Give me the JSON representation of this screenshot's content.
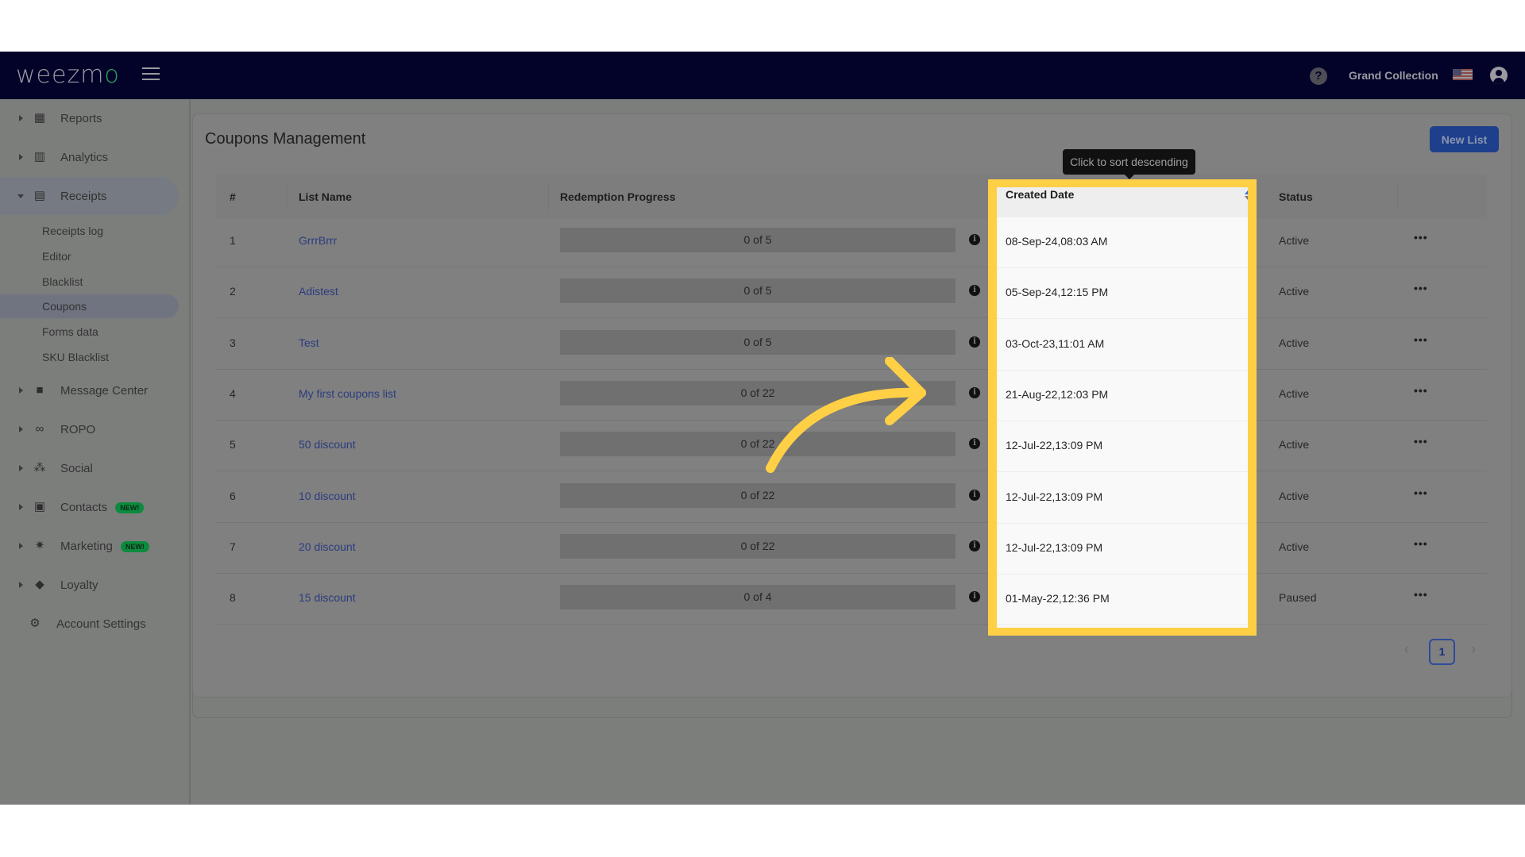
{
  "topbar": {
    "logo_text": "weezm",
    "logo_o": "o",
    "help_icon": "?",
    "account_name": "Grand Collection",
    "flag": "us-flag-icon",
    "user_icon": "user-circle-icon"
  },
  "sidebar": {
    "items": [
      {
        "label": "Reports",
        "icon": "dashboard-icon",
        "expanded": false
      },
      {
        "label": "Analytics",
        "icon": "analytics-icon",
        "expanded": false
      },
      {
        "label": "Receipts",
        "icon": "receipt-icon",
        "expanded": true
      },
      {
        "label": "Message Center",
        "icon": "chat-icon",
        "expanded": false
      },
      {
        "label": "ROPO",
        "icon": "infinity-icon",
        "expanded": false
      },
      {
        "label": "Social",
        "icon": "people-icon",
        "expanded": false
      },
      {
        "label": "Contacts",
        "icon": "contacts-icon",
        "badge": "NEW!",
        "expanded": false
      },
      {
        "label": "Marketing",
        "icon": "party-icon",
        "badge": "NEW!",
        "expanded": false
      },
      {
        "label": "Loyalty",
        "icon": "tag-icon",
        "expanded": false
      },
      {
        "label": "Account Settings",
        "icon": "gear-icon"
      }
    ],
    "receipts_sub": [
      {
        "label": "Receipts log"
      },
      {
        "label": "Editor"
      },
      {
        "label": "Blacklist"
      },
      {
        "label": "Coupons",
        "active": true
      },
      {
        "label": "Forms data"
      },
      {
        "label": "SKU Blacklist"
      }
    ]
  },
  "main": {
    "title": "Coupons Management",
    "new_list_label": "New List",
    "tooltip": "Click to sort descending",
    "columns": [
      "#",
      "List Name",
      "Redemption Progress",
      "Created Date",
      "Status"
    ],
    "rows": [
      {
        "num": "1",
        "name": "GrrrBrrr",
        "progress": "0 of 5",
        "redeemed": 0,
        "total": 5,
        "created": "08-Sep-24,08:03 AM",
        "status": "Active"
      },
      {
        "num": "2",
        "name": "Adistest",
        "progress": "0 of 5",
        "redeemed": 0,
        "total": 5,
        "created": "05-Sep-24,12:15 PM",
        "status": "Active"
      },
      {
        "num": "3",
        "name": "Test",
        "progress": "0 of 5",
        "redeemed": 0,
        "total": 5,
        "created": "03-Oct-23,11:01 AM",
        "status": "Active"
      },
      {
        "num": "4",
        "name": "My first coupons list",
        "progress": "0 of 22",
        "redeemed": 0,
        "total": 22,
        "created": "21-Aug-22,12:03 PM",
        "status": "Active"
      },
      {
        "num": "5",
        "name": "50 discount",
        "progress": "0 of 22",
        "redeemed": 0,
        "total": 22,
        "created": "12-Jul-22,13:09 PM",
        "status": "Active"
      },
      {
        "num": "6",
        "name": "10 discount",
        "progress": "0 of 22",
        "redeemed": 0,
        "total": 22,
        "created": "12-Jul-22,13:09 PM",
        "status": "Active"
      },
      {
        "num": "7",
        "name": "20 discount",
        "progress": "0 of 22",
        "redeemed": 0,
        "total": 22,
        "created": "12-Jul-22,13:09 PM",
        "status": "Active"
      },
      {
        "num": "8",
        "name": "15 discount",
        "progress": "0 of 4",
        "redeemed": 0,
        "total": 4,
        "created": "01-May-22,12:36 PM",
        "status": "Paused"
      }
    ],
    "row_actions": "•••",
    "info_glyph": "i"
  },
  "pagination": {
    "prev": "‹",
    "current": "1",
    "next": "›"
  },
  "colors": {
    "topbar": "#03032a",
    "highlight": "#ffcf45",
    "link": "#2a3c7e",
    "primary_button": "#1e3f8c",
    "badge_new": "#0c8a3e"
  }
}
